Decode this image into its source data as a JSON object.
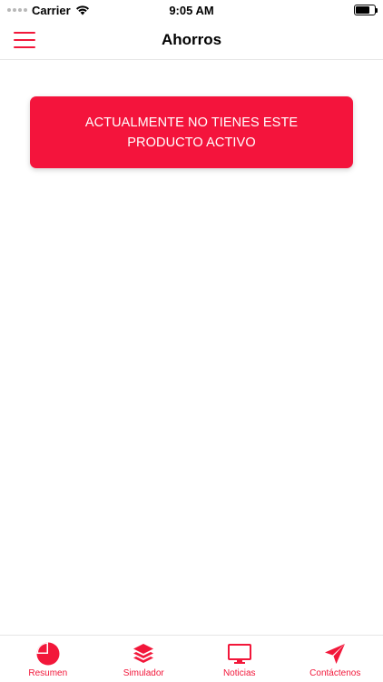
{
  "status_bar": {
    "carrier": "Carrier",
    "time": "9:05 AM",
    "battery_level": 0.75
  },
  "nav_bar": {
    "title": "Ahorros",
    "menu_icon": "hamburger-menu-icon"
  },
  "alert": {
    "message": "ACTUALMENTE NO TIENES ESTE PRODUCTO ACTIVO"
  },
  "tab_bar": {
    "items": [
      {
        "label": "Resumen",
        "icon": "pie-chart-icon"
      },
      {
        "label": "Simulador",
        "icon": "layers-icon"
      },
      {
        "label": "Noticias",
        "icon": "monitor-icon"
      },
      {
        "label": "Contáctenos",
        "icon": "paper-plane-icon"
      }
    ]
  },
  "colors": {
    "accent": "#f2173a",
    "banner": "#f4143c",
    "background": "#ffffff"
  }
}
